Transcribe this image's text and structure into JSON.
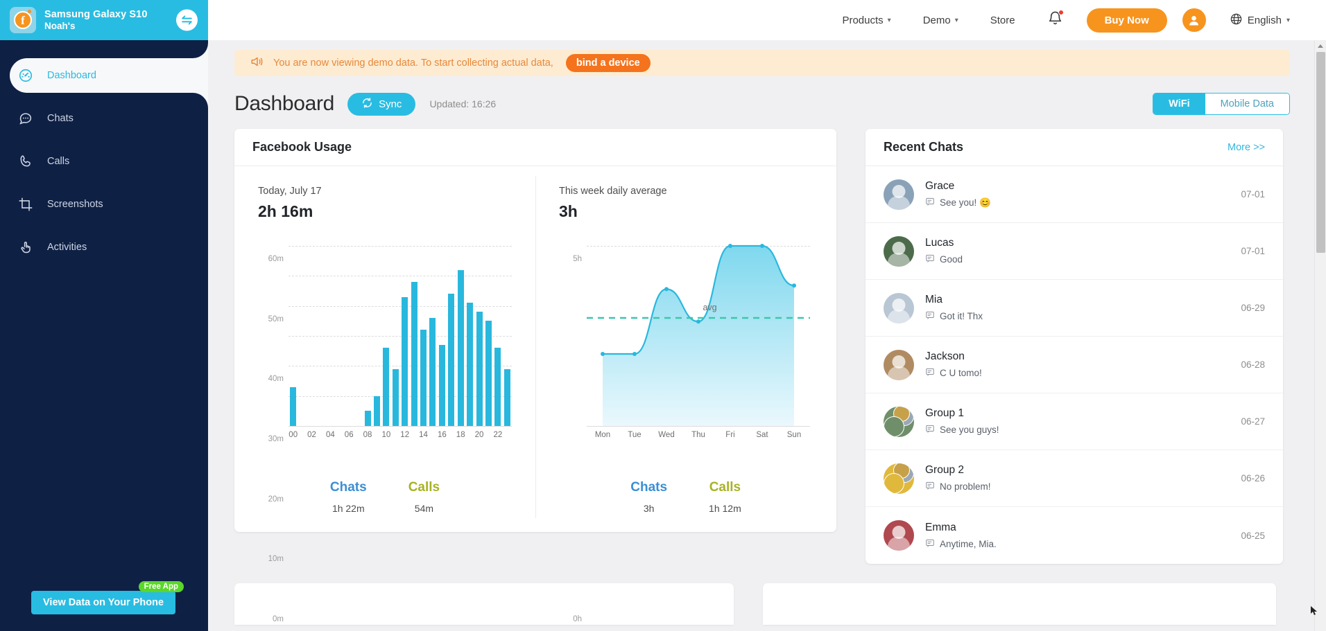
{
  "sidebar": {
    "device": {
      "name": "Samsung Galaxy S10",
      "owner": "Noah's",
      "app_icon": "facebook-icon",
      "switch_icon": "switch-device-icon"
    },
    "items": [
      {
        "label": "Dashboard",
        "icon": "dashboard-gauge-icon",
        "active": true
      },
      {
        "label": "Chats",
        "icon": "chat-bubble-icon",
        "active": false
      },
      {
        "label": "Calls",
        "icon": "phone-icon",
        "active": false
      },
      {
        "label": "Screenshots",
        "icon": "crop-frame-icon",
        "active": false
      },
      {
        "label": "Activities",
        "icon": "hand-pointer-icon",
        "active": false
      }
    ],
    "cta": {
      "label": "View Data on Your Phone",
      "badge": "Free App"
    }
  },
  "topbar": {
    "links": [
      {
        "label": "Products",
        "caret": true
      },
      {
        "label": "Demo",
        "caret": true
      },
      {
        "label": "Store",
        "caret": false
      }
    ],
    "bell_icon": "notification-bell-icon",
    "has_notification": true,
    "buy_now": "Buy Now",
    "avatar_icon": "user-avatar-icon",
    "globe_icon": "globe-icon",
    "language": "English"
  },
  "banner": {
    "icon": "megaphone-icon",
    "text": "You are now viewing demo data. To start collecting actual data,",
    "button": "bind a device"
  },
  "page": {
    "title": "Dashboard",
    "sync_label": "Sync",
    "sync_icon": "sync-refresh-icon",
    "updated": "Updated: 16:26",
    "network": {
      "wifi": "WiFi",
      "mobile": "Mobile Data",
      "selected": "WiFi"
    }
  },
  "usage_card": {
    "title": "Facebook Usage",
    "today": {
      "label": "Today, July 17",
      "total": "2h 16m"
    },
    "week": {
      "label": "This week daily average",
      "total": "3h"
    },
    "today_stats": [
      {
        "name": "Chats",
        "value": "1h 22m",
        "color": "#3b8fd4"
      },
      {
        "name": "Calls",
        "value": "54m",
        "color": "#a8b225"
      }
    ],
    "week_stats": [
      {
        "name": "Chats",
        "value": "3h",
        "color": "#3b8fd4"
      },
      {
        "name": "Calls",
        "value": "1h 12m",
        "color": "#a8b225"
      }
    ]
  },
  "chart_data": [
    {
      "type": "bar",
      "title": "Today, July 17",
      "xlabel": "",
      "ylabel": "",
      "ylim": [
        0,
        60
      ],
      "yticks": [
        0,
        10,
        20,
        30,
        40,
        50,
        60
      ],
      "ytick_labels": [
        "0m",
        "10m",
        "20m",
        "30m",
        "40m",
        "50m",
        "60m"
      ],
      "grid": true,
      "categories": [
        "00",
        "01",
        "02",
        "03",
        "04",
        "05",
        "06",
        "07",
        "08",
        "09",
        "10",
        "11",
        "12",
        "13",
        "14",
        "15",
        "16",
        "17",
        "18",
        "19",
        "20",
        "21",
        "22",
        "23"
      ],
      "xtick_labels": [
        "00",
        "02",
        "04",
        "06",
        "08",
        "10",
        "12",
        "14",
        "16",
        "18",
        "20",
        "22"
      ],
      "values": [
        13,
        0,
        0,
        0,
        0,
        0,
        0,
        0,
        5,
        10,
        26,
        19,
        43,
        48,
        32,
        36,
        27,
        44,
        52,
        41,
        38,
        35,
        26,
        19
      ],
      "bar_color": "#29b8dd"
    },
    {
      "type": "area",
      "title": "This week daily average",
      "xlabel": "",
      "ylabel": "",
      "ylim": [
        0,
        5
      ],
      "yticks": [
        0,
        5
      ],
      "ytick_labels": [
        "0h",
        "5h"
      ],
      "grid": true,
      "categories": [
        "Mon",
        "Tue",
        "Wed",
        "Thu",
        "Fri",
        "Sat",
        "Sun"
      ],
      "values": [
        2.0,
        2.0,
        3.8,
        2.9,
        5.0,
        5.0,
        3.9
      ],
      "annotations": [
        {
          "label": "avg",
          "value": 3.0,
          "style": "dashed-line",
          "color": "#3cc6b0"
        }
      ],
      "line_color": "#29b8dd",
      "fill_from": "#7fd8ee",
      "fill_to": "#eaf8fd"
    }
  ],
  "recent_chats": {
    "title": "Recent Chats",
    "more": "More >>",
    "rows": [
      {
        "name": "Grace",
        "message": "See you! 😊",
        "date": "07-01",
        "avatar_color": "#8aa2b8",
        "group": false
      },
      {
        "name": "Lucas",
        "message": "Good",
        "date": "07-01",
        "avatar_color": "#4c6b4a",
        "group": false
      },
      {
        "name": "Mia",
        "message": "Got it! Thx",
        "date": "06-29",
        "avatar_color": "#b9c6d4",
        "group": false
      },
      {
        "name": "Jackson",
        "message": "C U tomo!",
        "date": "06-28",
        "avatar_color": "#b08b62",
        "group": false
      },
      {
        "name": "Group 1",
        "message": "See you guys!",
        "date": "06-27",
        "avatar_color": "#6f8f6a",
        "group": true
      },
      {
        "name": "Group 2",
        "message": "No problem!",
        "date": "06-26",
        "avatar_color": "#e0b93c",
        "group": true
      },
      {
        "name": "Emma",
        "message": "Anytime, Mia.",
        "date": "06-25",
        "avatar_color": "#b0484f",
        "group": false
      }
    ]
  },
  "colors": {
    "accent_cyan": "#29bce2",
    "accent_orange": "#f7941e",
    "sidebar_bg": "#0f2045",
    "bar_blue": "#29b8dd",
    "avg_green": "#3cc6b0"
  }
}
